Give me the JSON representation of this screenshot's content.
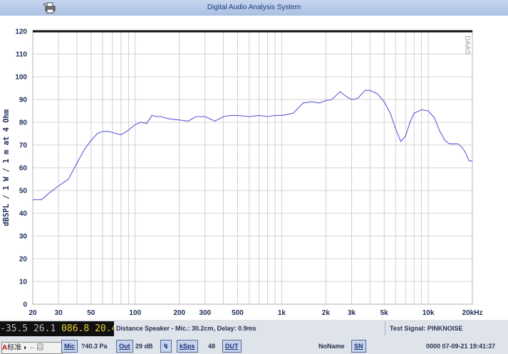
{
  "window": {
    "title": "Digital Audio Analysis System"
  },
  "chart_data": {
    "type": "line",
    "xscale": "log",
    "xlim": [
      20,
      20000
    ],
    "ylim": [
      0,
      120
    ],
    "ylabel": "dBSPL / 1 W / 1 m at 4 Ohm",
    "watermark": "DAAS",
    "grid": true,
    "line_color": "#5b5bd6",
    "yticks": [
      0,
      10,
      20,
      30,
      40,
      50,
      60,
      70,
      80,
      90,
      100,
      110,
      120
    ],
    "xticks": [
      {
        "v": 20,
        "label": "20"
      },
      {
        "v": 30,
        "label": "30"
      },
      {
        "v": 50,
        "label": "50"
      },
      {
        "v": 100,
        "label": "100"
      },
      {
        "v": 200,
        "label": "200"
      },
      {
        "v": 300,
        "label": "300"
      },
      {
        "v": 500,
        "label": "500"
      },
      {
        "v": 1000,
        "label": "1k"
      },
      {
        "v": 2000,
        "label": "2k"
      },
      {
        "v": 3000,
        "label": "3k"
      },
      {
        "v": 5000,
        "label": "5k"
      },
      {
        "v": 10000,
        "label": "10k"
      },
      {
        "v": 20000,
        "label": "20kHz"
      }
    ],
    "series": [
      {
        "x": [
          20,
          23,
          26,
          30,
          35,
          40,
          45,
          50,
          55,
          60,
          65,
          70,
          80,
          90,
          100,
          110,
          120,
          130,
          140,
          150,
          170,
          200,
          230,
          260,
          300,
          350,
          400,
          450,
          500,
          600,
          700,
          800,
          900,
          1000,
          1100,
          1200,
          1400,
          1600,
          1800,
          2000,
          2200,
          2500,
          2800,
          3000,
          3300,
          3700,
          4000,
          4500,
          5000,
          5500,
          6000,
          6500,
          7000,
          7500,
          8000,
          9000,
          10000,
          11000,
          12000,
          13000,
          14000,
          15000,
          16000,
          17000,
          18000,
          19000,
          20000
        ],
        "y": [
          46,
          46,
          49,
          52,
          55,
          62,
          68,
          72,
          75,
          76,
          76,
          75.5,
          74.5,
          76.5,
          79,
          80,
          79.5,
          83,
          82.5,
          82.5,
          81.5,
          81,
          80.5,
          82.5,
          82.5,
          80.5,
          82.5,
          83,
          83,
          82.5,
          83,
          82.5,
          83,
          83,
          83.5,
          84,
          88.5,
          89,
          88.5,
          89.5,
          90,
          93.5,
          91,
          90,
          90.5,
          94,
          94,
          92.5,
          89,
          84,
          77,
          71.5,
          74,
          80,
          84,
          85.5,
          85,
          82,
          76,
          72,
          70.5,
          70.5,
          70.5,
          69,
          66.5,
          63,
          63
        ]
      }
    ]
  },
  "status": {
    "lcd_left": "-35.5 26.1",
    "lcd_right": "086.8 20.4",
    "distance": "Distance Speaker - Mic.: 30.2cm, Delay: 0.9ms",
    "signal": "Test Signal: PINKNOISE",
    "mic_btn": "Mic",
    "pressure": "?40.3 Pa",
    "out_btn": "Out",
    "out_db": "29 dB",
    "ksps_btn": "kSps",
    "ksps_val": "48",
    "dut_btn": "DUT",
    "dut_name": "NoName",
    "sn_btn": "SN",
    "datetime": "0000 07-09-21 19:41:37",
    "ime_text": "标准"
  }
}
